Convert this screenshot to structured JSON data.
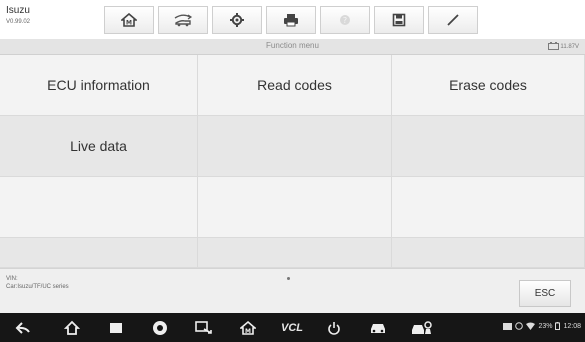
{
  "app": {
    "name": "Isuzu",
    "version": "V0.99.02"
  },
  "toolbar": {
    "buttons": [
      {
        "name": "home-button",
        "icon": "home-icon"
      },
      {
        "name": "vehicle-swap-button",
        "icon": "car-swap-icon"
      },
      {
        "name": "settings-button",
        "icon": "gear-icon"
      },
      {
        "name": "print-button",
        "icon": "printer-icon"
      },
      {
        "name": "help-button",
        "icon": "help-icon"
      },
      {
        "name": "save-button",
        "icon": "save-icon"
      },
      {
        "name": "edit-button",
        "icon": "pen-icon"
      }
    ]
  },
  "header": {
    "title": "Function menu",
    "battery_voltage": "11.87V"
  },
  "menu": {
    "items": [
      "ECU information",
      "Read codes",
      "Erase codes",
      "Live data"
    ]
  },
  "footer": {
    "vin_label": "VIN:",
    "car_info": "Car:Isuzu/TF/UC series",
    "esc_label": "ESC"
  },
  "statusbar": {
    "battery_percent": "23%",
    "time": "12:08",
    "vcl_label": "VCL"
  },
  "colors": {
    "cell_light": "#f3f3f3",
    "cell_dark": "#e7e7e7",
    "navbar": "#161616"
  }
}
